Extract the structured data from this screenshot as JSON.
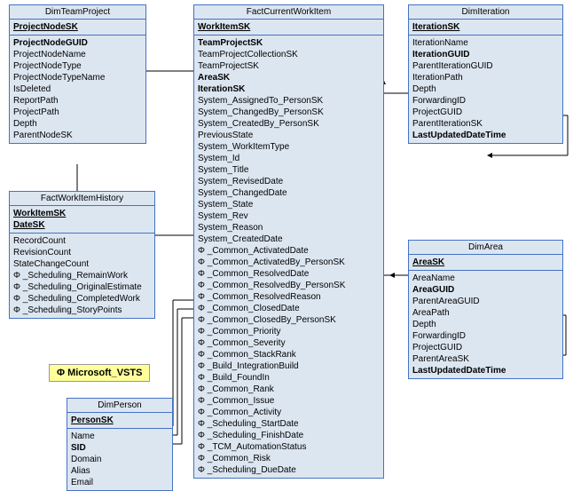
{
  "entities": {
    "dimTeamProject": {
      "title": "DimTeamProject",
      "pk_section": [
        "ProjectNodeSK"
      ],
      "sections": [
        [
          "ProjectNodeGUID",
          "ProjectNodeName",
          "ProjectNodeType",
          "ProjectNodeTypeName",
          "IsDeleted",
          "ReportPath",
          "ProjectPath",
          "Depth",
          "ParentNodeSK"
        ]
      ]
    },
    "factCurrentWorkItem": {
      "title": "FactCurrentWorkItem",
      "pk_section": [
        "WorkItemSK"
      ],
      "sections": [
        [
          "TeamProjectSK",
          "TeamProjectCollectionSK",
          "TeamProjectSK",
          "AreaSK",
          "IterationSK",
          "System_AssignedTo_PersonSK",
          "System_ChangedBy_PersonSK",
          "System_CreatedBy_PersonSK",
          "PreviousState",
          "System_WorkItemType",
          "System_Id",
          "System_Title",
          "System_RevisedDate",
          "System_ChangedDate",
          "System_State",
          "System_Rev",
          "System_Reason",
          "System_CreatedDate",
          "Φ _Common_ActivatedDate",
          "Φ _Common_ActivatedBy_PersonSK",
          "Φ _Common_ResolvedDate",
          "Φ _Common_ResolvedBy_PersonSK",
          "Φ _Common_ResolvedReason",
          "Φ _Common_ClosedDate",
          "Φ _Common_ClosedBy_PersonSK",
          "Φ _Common_Priority",
          "Φ _Common_Severity",
          "Φ _Common_StackRank",
          "Φ _Build_IntegrationBuild",
          "Φ _Build_FoundIn",
          "Φ _Common_Rank",
          "Φ _Common_Issue",
          "Φ _Common_Activity",
          "Φ _Scheduling_StartDate",
          "Φ _Scheduling_FinishDate",
          "Φ _TCM_AutomationStatus",
          "Φ _Common_Risk",
          "Φ _Scheduling_DueDate"
        ]
      ]
    },
    "dimIteration": {
      "title": "DimIteration",
      "pk_section": [
        "IterationSK"
      ],
      "sections": [
        [
          "IterationName",
          "IterationGUID",
          "ParentIterationGUID",
          "IterationPath",
          "Depth",
          "ForwardingID",
          "ProjectGUID",
          "ParentIterationSK",
          "LastUpdatedDateTime"
        ]
      ]
    },
    "factWorkItemHistory": {
      "title": "FactWorkItemHistory",
      "pk_section": [
        "WorkItemSK",
        "DateSK"
      ],
      "sections": [
        [
          "RecordCount",
          "RevisionCount",
          "StateChangeCount",
          "Φ _Scheduling_RemainWork",
          "Φ _Scheduling_OriginalEstimate",
          "Φ _Scheduling_CompletedWork",
          "Φ _Scheduling_StoryPoints"
        ]
      ]
    },
    "dimPerson": {
      "title": "DimPerson",
      "pk_section": [
        "PersonSK"
      ],
      "sections": [
        [
          "Name",
          "SID",
          "Domain",
          "Alias",
          "Email"
        ]
      ]
    },
    "dimArea": {
      "title": "DimArea",
      "pk_section": [
        "AreaSK"
      ],
      "sections": [
        [
          "AreaName",
          "AreaGUID",
          "ParentAreaGUID",
          "AreaPath",
          "Depth",
          "ForwardingID",
          "ProjectGUID",
          "ParentAreaSK",
          "LastUpdatedDateTime"
        ]
      ]
    }
  },
  "yellowBox": {
    "label": "Φ  Microsoft_VSTS"
  }
}
